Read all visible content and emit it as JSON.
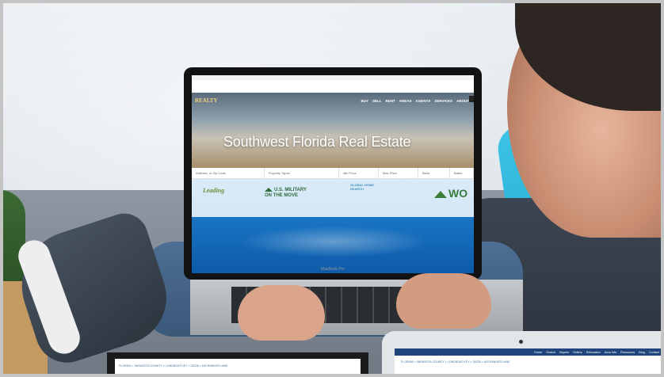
{
  "laptop": {
    "brand": "MacBook Pro",
    "site": {
      "logo": "REALTY",
      "nav": [
        "BUY",
        "SELL",
        "RENT",
        "AREAS",
        "AGENTS",
        "SERVICES",
        "ABOUT"
      ],
      "hero_title": "Southwest Florida Real Estate",
      "search_fields": [
        "Address, or Zip Code",
        "Property Types",
        "Min Price",
        "Max Price",
        "Beds",
        "Baths"
      ],
      "partners": {
        "leading": "Leading",
        "military_line1": "U.S. MILITARY",
        "military_line2": "ON THE MOVE",
        "global_line1": "GLOBAL HOME",
        "global_line2": "SEARCH",
        "wo": "WO"
      }
    }
  },
  "second_screen": {
    "breadcrumb": "FLORIDA > SARASOTA COUNTY > LONGBOAT KEY > 34228 > 643 RANGER LANE"
  },
  "tablet": {
    "nav": [
      "Home",
      "Search",
      "Buyers",
      "Sellers",
      "Relocation",
      "Area Info",
      "Resources",
      "Blog",
      "Contact"
    ],
    "breadcrumb": "FLORIDA > SARASOTA COUNTY > LONGBOAT KEY > 34228 > 643 RANGER LANE"
  },
  "colors": {
    "cushion": "#1aa1cc",
    "pool": "#1873c2",
    "tablet_nav": "#20457c",
    "logo_gold": "#f3d27a"
  }
}
